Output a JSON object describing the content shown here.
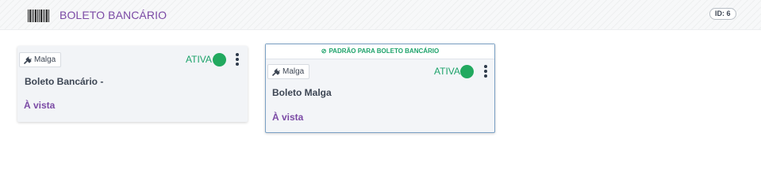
{
  "header": {
    "icon": "barcode-icon",
    "title": "BOLETO BANCÁRIO",
    "id_label": "ID: 6"
  },
  "colors": {
    "accent_purple": "#7b4aa5",
    "status_green": "#22a95f",
    "default_text_green": "#1ea36b",
    "card_bg": "#f2f4f7",
    "selected_border": "#7aa0c4"
  },
  "cards": [
    {
      "integration_icon": "plug-icon",
      "integration": "Malga",
      "status": "ATIVA",
      "name": "Boleto Bancário -",
      "terms": "À vista",
      "is_default": false
    },
    {
      "default_icon": "check-circle-icon",
      "default_label": "PADRÃO PARA BOLETO BANCÁRIO",
      "integration_icon": "plug-icon",
      "integration": "Malga",
      "status": "ATIVA",
      "name": "Boleto Malga",
      "terms": "À vista",
      "is_default": true
    }
  ]
}
